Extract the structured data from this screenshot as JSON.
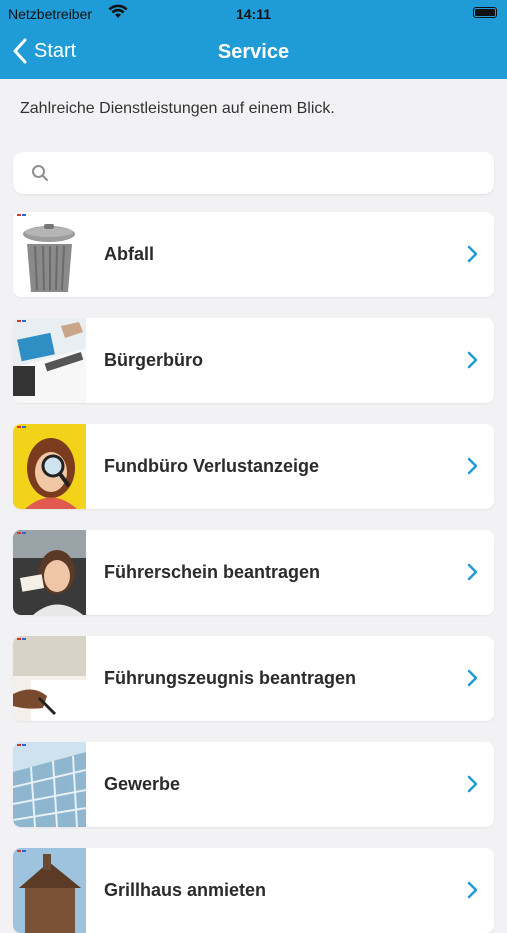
{
  "status_bar": {
    "carrier": "Netzbetreiber",
    "time": "14:11"
  },
  "nav": {
    "back_label": "Start",
    "title": "Service"
  },
  "intro_text": "Zahlreiche Dienstleistungen auf einem Blick.",
  "search": {
    "placeholder": "",
    "value": ""
  },
  "colors": {
    "accent": "#1f9bd7",
    "background": "#f2f2f4",
    "chevron": "#1f9bd7"
  },
  "items": [
    {
      "label": "Abfall",
      "icon": "trash-can-photo"
    },
    {
      "label": "Bürgerbüro",
      "icon": "office-desk-photo"
    },
    {
      "label": "Fundbüro Verlustanzeige",
      "icon": "magnifier-woman-photo"
    },
    {
      "label": "Führerschein beantragen",
      "icon": "driver-license-photo"
    },
    {
      "label": "Führungszeugnis beantragen",
      "icon": "signing-document-photo"
    },
    {
      "label": "Gewerbe",
      "icon": "glass-building-photo"
    },
    {
      "label": "Grillhaus anmieten",
      "icon": "grill-house-photo"
    }
  ]
}
